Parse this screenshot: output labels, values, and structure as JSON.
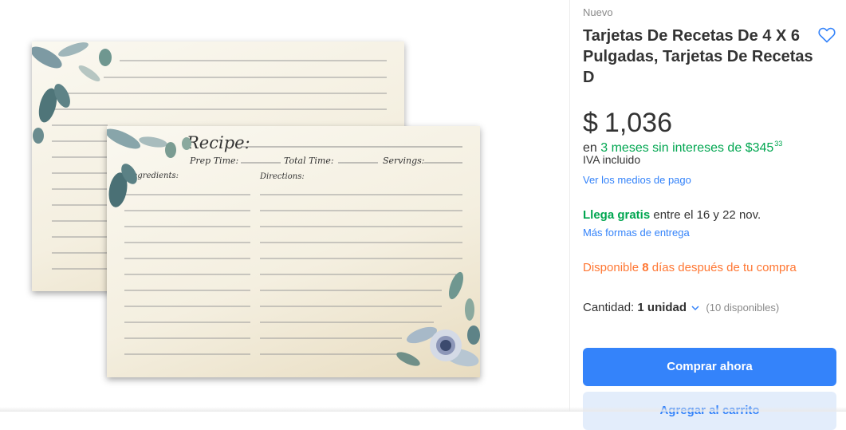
{
  "product": {
    "condition": "Nuevo",
    "title": "Tarjetas De Recetas De 4 X 6 Pulgadas, Tarjetas De Recetas D",
    "favorite_icon": "heart-outline-icon"
  },
  "card_image": {
    "recipe_label": "Recipe:",
    "prep_time_label": "Prep Time:",
    "total_time_label": "Total Time:",
    "servings_label": "Servings:",
    "ingredients_label": "Ingredients:",
    "directions_label": "Directions:"
  },
  "price": {
    "currency": "$",
    "amount": "1,036"
  },
  "installments": {
    "prefix": "en",
    "text": "3 meses sin intereses de",
    "currency": "$",
    "amount": "345",
    "cents": "33"
  },
  "tax_note": "IVA incluido",
  "payment_link": "Ver los medios de pago",
  "shipping": {
    "highlight": "Llega gratis",
    "dates": "entre el 16 y 22 nov.",
    "more_link": "Más formas de entrega"
  },
  "availability": {
    "prefix": "Disponible",
    "days": "8",
    "suffix": "días después de tu compra"
  },
  "quantity": {
    "label": "Cantidad:",
    "value": "1 unidad",
    "available": "(10 disponibles)"
  },
  "buttons": {
    "buy_now": "Comprar ahora",
    "add_to_cart": "Agregar al carrito"
  },
  "colors": {
    "accent": "#3483fa",
    "success": "#00a650",
    "warning": "#ff7733"
  }
}
